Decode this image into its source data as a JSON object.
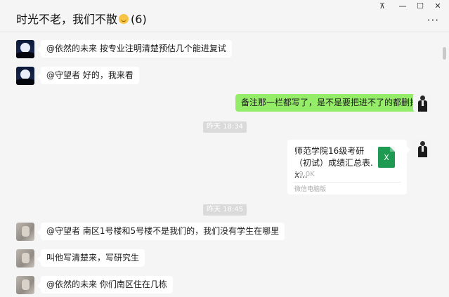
{
  "header": {
    "title": "时光不老，我们不散",
    "member_count": "(6)",
    "more_label": "···",
    "emoji_icon": "grin-emoji-icon"
  },
  "window_controls": {
    "pin": "⊼",
    "minimize": "—",
    "maximize": "☐",
    "close": "✕"
  },
  "messages": [
    {
      "side": "left",
      "avatar": "night-moon-avatar",
      "text": "@依然的未来 按专业注明清楚预估几个能进复试"
    },
    {
      "side": "left",
      "avatar": "night-moon-avatar",
      "text": "@守望者 好的，我来看"
    },
    {
      "side": "right",
      "avatar": "suit-man-avatar",
      "text": "备注那一栏都写了，是不是要把进不了的都删掉"
    }
  ],
  "timestamps": [
    "昨天 18:34",
    "昨天 18:45"
  ],
  "file_message": {
    "name": "师范学院16级考研（初试）成绩汇总表.x...",
    "size": "19.0K",
    "source": "微信电脑版",
    "icon_letter": "X",
    "icon": "excel-file-icon"
  },
  "later_messages": [
    {
      "side": "left",
      "avatar": "gray-photo-avatar",
      "text": "@守望者 南区1号楼和5号楼不是我们的，我们没有学生在哪里"
    },
    {
      "side": "left",
      "avatar": "gray-photo-avatar",
      "text": "叫他写清楚来，写研究生"
    },
    {
      "side": "left",
      "avatar": "gray-photo-avatar",
      "text": "@依然的未来 你们南区住在几栋"
    }
  ],
  "colors": {
    "background": "#f5f5f5",
    "sent_bubble": "#95ec69",
    "received_bubble": "#ffffff",
    "timestamp_bg": "#dadada",
    "excel_green": "#1f9a53"
  }
}
